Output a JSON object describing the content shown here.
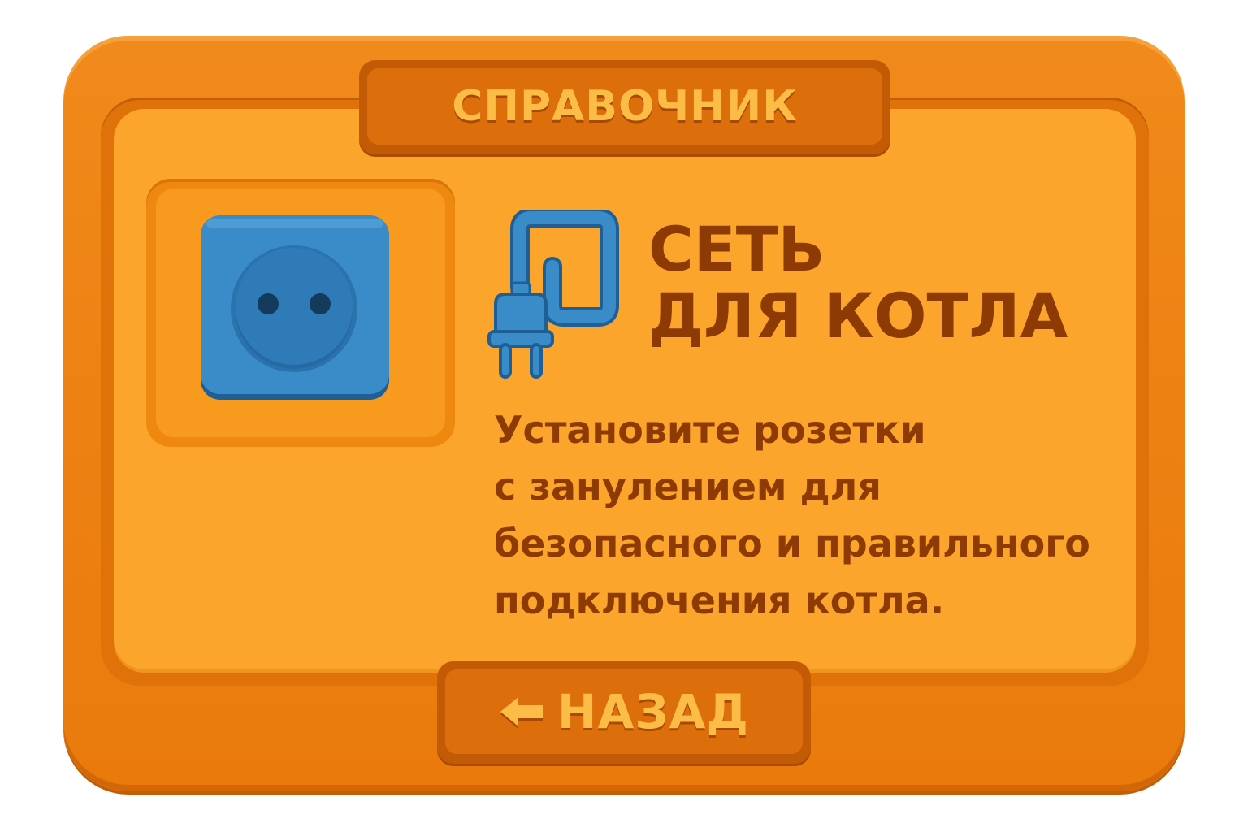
{
  "header": {
    "title": "СПРАВОЧНИК"
  },
  "card": {
    "heading_line1": "СЕТЬ",
    "heading_line2": "ДЛЯ КОТЛА",
    "description": [
      "Установите розетки",
      "с занулением для",
      "безопасного и правильного",
      "подключения котла."
    ],
    "image_icon": "power-socket-icon",
    "heading_icon": "power-plug-icon"
  },
  "footer": {
    "back_label": "НАЗАД",
    "back_icon": "arrow-left-icon"
  },
  "colors": {
    "frame": "#ea7a0c",
    "panel": "#fba52c",
    "tab": "#dd6e0c",
    "tab_text": "#fbbd45",
    "body_text": "#8e3a05",
    "icon_blue": "#3a8cc8"
  }
}
